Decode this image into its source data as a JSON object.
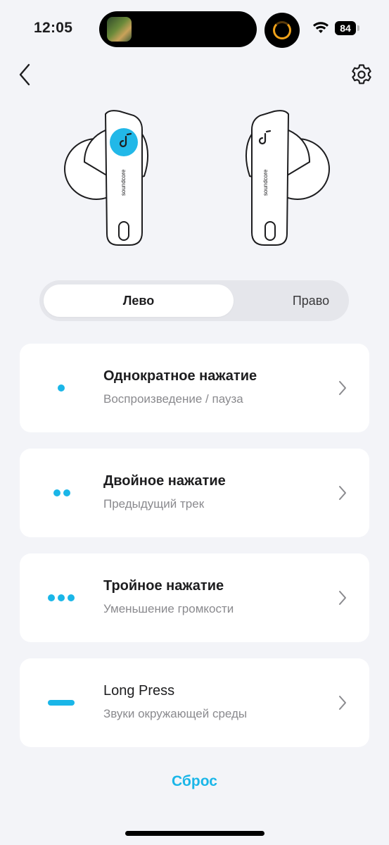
{
  "status": {
    "time": "12:05",
    "battery": "84"
  },
  "segment": {
    "left_label": "Лево",
    "right_label": "Право",
    "selected": "left"
  },
  "earbuds": {
    "brand": "soundcore"
  },
  "controls": [
    {
      "title": "Однократное нажатие",
      "subtitle": "Воспроизведение / пауза",
      "gesture": "single-dot"
    },
    {
      "title": "Двойное нажатие",
      "subtitle": "Предыдущий трек",
      "gesture": "double-dot"
    },
    {
      "title": "Тройное нажатие",
      "subtitle": "Уменьшение громкости",
      "gesture": "triple-dot"
    },
    {
      "title": "Long Press",
      "subtitle": "Звуки окружающей среды",
      "gesture": "dash"
    }
  ],
  "reset_label": "Сброс",
  "colors": {
    "accent": "#1ab6e8",
    "background": "#f3f4f8",
    "card": "#ffffff"
  },
  "icons": [
    "back-chevron-icon",
    "gear-icon",
    "chevron-right-icon"
  ]
}
